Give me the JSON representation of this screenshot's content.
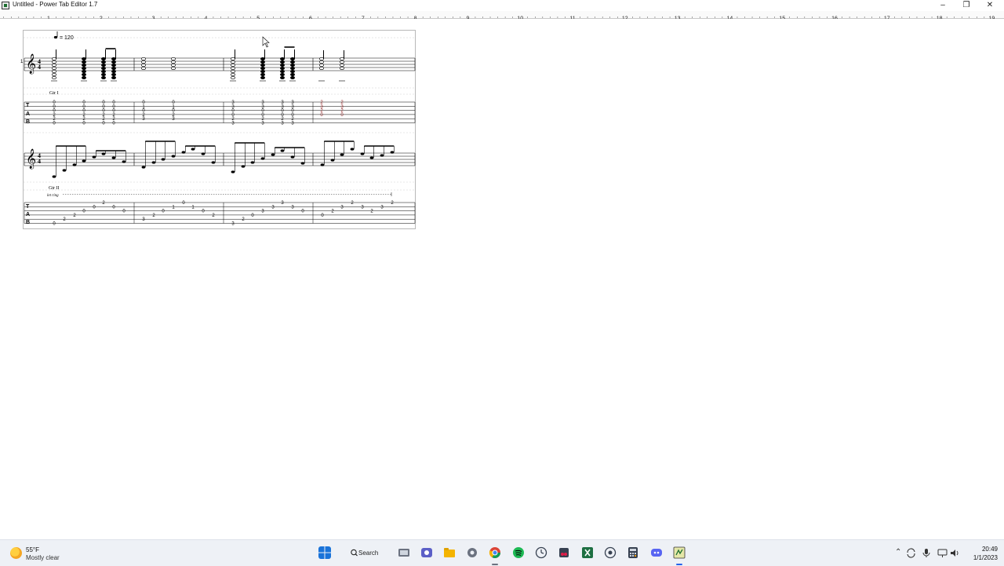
{
  "window": {
    "title": "Untitled - Power Tab Editor 1.7",
    "controls": [
      "minimize",
      "restore",
      "close"
    ]
  },
  "ruler": {
    "numbers": [
      "1",
      "2",
      "3",
      "4",
      "5",
      "6",
      "7",
      "8",
      "9",
      "10",
      "11",
      "12",
      "13",
      "14",
      "15",
      "16",
      "17",
      "18",
      "19"
    ]
  },
  "score": {
    "tempo_label": "= 120",
    "guitar1_label": "Gtr I",
    "guitar2_label": "Gtr II",
    "let_ring_label": "let ring",
    "tab_clef": [
      "T",
      "A",
      "B"
    ],
    "staff_number": "1",
    "time_signature": [
      "4",
      "4"
    ],
    "guitar1_tab": [
      {
        "chord": [
          "0",
          "0",
          "0",
          "2",
          "2",
          "0"
        ]
      },
      {
        "chord": [
          "0",
          "0",
          "0",
          "2",
          "2",
          "0"
        ]
      },
      {
        "chord": [
          "0",
          "0",
          "0",
          "2",
          "2",
          "0"
        ]
      },
      {
        "chord": [
          "0",
          "0",
          "0",
          "2",
          "2",
          "0"
        ]
      },
      {
        "chord": [
          "0",
          "1",
          "0",
          "2",
          "3",
          ""
        ]
      },
      {
        "chord": [
          "0",
          "1",
          "0",
          "2",
          "3",
          ""
        ]
      },
      {
        "chord": [
          "3",
          "3",
          "0",
          "0",
          "2",
          "3"
        ]
      },
      {
        "chord": [
          "3",
          "3",
          "0",
          "0",
          "2",
          "3"
        ]
      },
      {
        "chord": [
          "3",
          "3",
          "0",
          "0",
          "2",
          "3"
        ]
      },
      {
        "chord": [
          "3",
          "3",
          "0",
          "0",
          "2",
          "3"
        ]
      },
      {
        "chord": [
          "2",
          "3",
          "2",
          "0",
          "",
          ""
        ]
      },
      {
        "chord": [
          "2",
          "3",
          "2",
          "0",
          "",
          ""
        ]
      }
    ],
    "guitar2_tab": {
      "measure1": [
        "0",
        "2",
        "2",
        "0",
        "0",
        "2",
        "0",
        "0"
      ],
      "measure2": [
        "3",
        "2",
        "0",
        "1",
        "0",
        "1",
        "0",
        "2"
      ],
      "measure3": [
        "3",
        "2",
        "0",
        "3",
        "3",
        "3",
        "3",
        "0"
      ],
      "measure4": [
        "0",
        "2",
        "3",
        "2",
        "3",
        "2",
        "3",
        "2"
      ]
    }
  },
  "taskbar": {
    "weather_temp": "55°F",
    "weather_desc": "Mostly clear",
    "search_label": "Search",
    "clock_time": "20:49",
    "clock_date": "1/1/2023",
    "apps": [
      "start",
      "search",
      "file-explorer-window",
      "teams",
      "file-explorer",
      "settings",
      "chrome",
      "spotify",
      "clock-app",
      "snipping-tool",
      "excel",
      "media-app",
      "calculator",
      "discord",
      "power-tab-editor"
    ]
  }
}
